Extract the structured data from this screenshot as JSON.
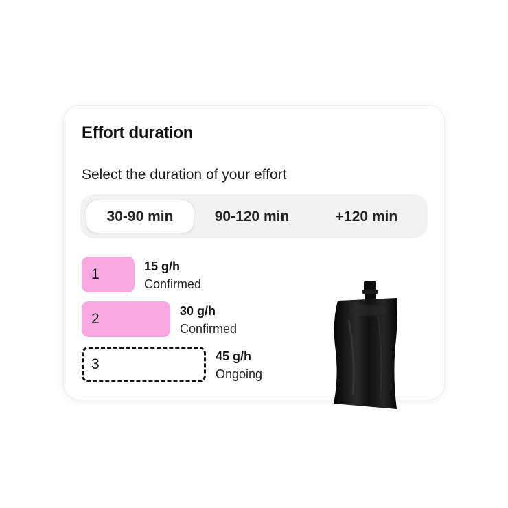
{
  "card": {
    "title": "Effort duration",
    "subtitle": "Select the duration of your effort"
  },
  "duration_options": [
    {
      "label": "30-90 min",
      "selected": true
    },
    {
      "label": "90-120 min",
      "selected": false
    },
    {
      "label": "+120 min",
      "selected": false
    }
  ],
  "steps": [
    {
      "number": "1",
      "rate": "15 g/h",
      "status": "Confirmed"
    },
    {
      "number": "2",
      "rate": "30 g/h",
      "status": "Confirmed"
    },
    {
      "number": "3",
      "rate": "45 g/h",
      "status": "Ongoing"
    }
  ],
  "colors": {
    "step_confirmed": "#f7a8e0",
    "segment_track": "#f2f2f2",
    "pouch": "#0d0d0d"
  },
  "icons": {
    "product": "energy-gel-pouch"
  }
}
